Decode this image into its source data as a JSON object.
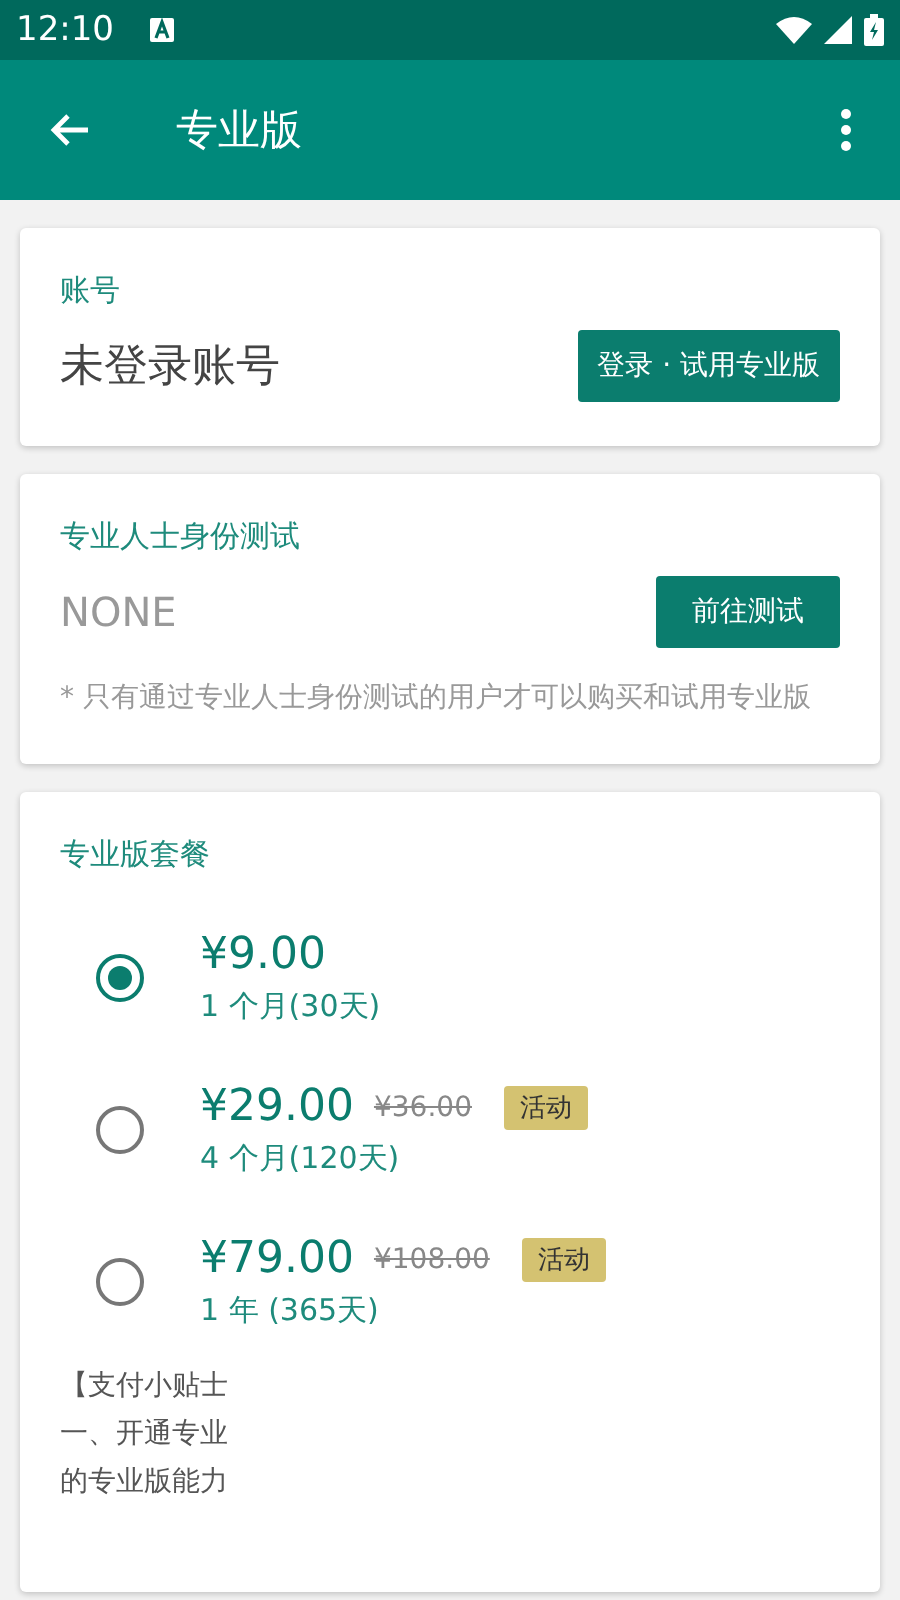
{
  "status_bar": {
    "time": "12:10"
  },
  "toolbar": {
    "title": "专业版"
  },
  "account": {
    "label": "账号",
    "value": "未登录账号",
    "button": "登录 · 试用专业版"
  },
  "identity_test": {
    "label": "专业人士身份测试",
    "value": "NONE",
    "button": "前往测试",
    "note": "* 只有通过专业人士身份测试的用户才可以购买和试用专业版"
  },
  "plans": {
    "label": "专业版套餐",
    "items": [
      {
        "price": "¥9.00",
        "duration": "1 个月(30天)",
        "selected": true
      },
      {
        "price": "¥29.00",
        "old_price": "¥36.00",
        "badge": "活动",
        "duration": "4 个月(120天)",
        "selected": false
      },
      {
        "price": "¥79.00",
        "old_price": "¥108.00",
        "badge": "活动",
        "duration": "1 年 (365天)",
        "selected": false
      }
    ],
    "tips": [
      "【支付小贴士",
      "一、开通专业",
      "的专业版能力"
    ]
  }
}
